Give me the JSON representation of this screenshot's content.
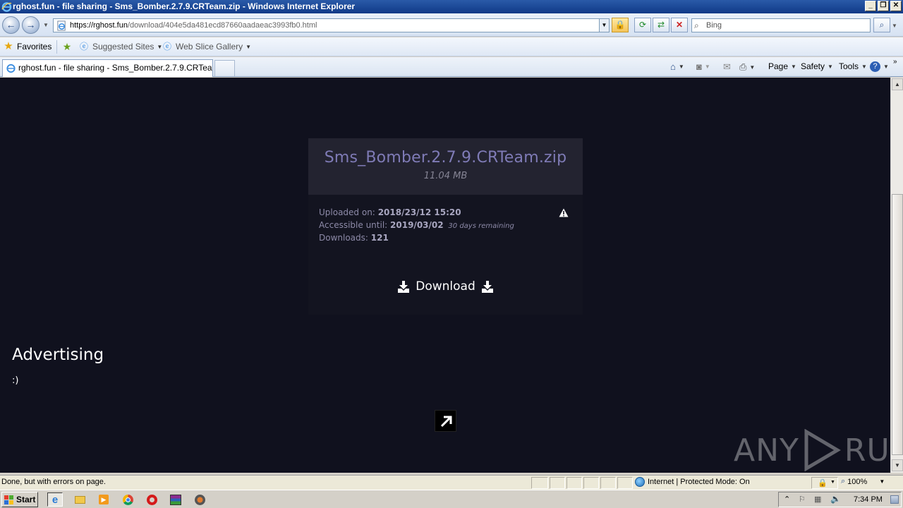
{
  "window": {
    "title": "rghost.fun - file sharing - Sms_Bomber.2.7.9.CRTeam.zip - Windows Internet Explorer",
    "controls": [
      "_",
      "❐",
      "✕"
    ]
  },
  "address_bar": {
    "url_host": "https://rghost.fun",
    "url_path": "/download/404e5da481ecd87660aadaeac3993fb0.html",
    "search_placeholder": "Bing"
  },
  "favorites_bar": {
    "favorites_label": "Favorites",
    "suggested_sites": "Suggested Sites",
    "web_slice_gallery": "Web Slice Gallery"
  },
  "tabs": {
    "active_label": "rghost.fun - file sharing - Sms_Bomber.2.7.9.CRTeam...."
  },
  "command_bar": {
    "page": "Page",
    "safety": "Safety",
    "tools": "Tools"
  },
  "page": {
    "file_name": "Sms_Bomber.2.7.9.CRTeam.zip",
    "file_size": "11.04 MB",
    "uploaded_label": "Uploaded on:",
    "uploaded_value": "2018/23/12 15:20",
    "accessible_label": "Accessible until:",
    "accessible_value": "2019/03/02",
    "accessible_note": "30 days remaining",
    "downloads_label": "Downloads:",
    "downloads_value": "121",
    "download_button": "Download",
    "advertising_title": "Advertising",
    "advertising_body": ":)",
    "watermark_left": "ANY",
    "watermark_right": "RUN"
  },
  "status_bar": {
    "status_text": "Done, but with errors on page.",
    "zone_text": "Internet | Protected Mode: On",
    "zoom_text": "100%"
  },
  "taskbar": {
    "start_label": "Start",
    "clock": "7:34 PM"
  },
  "colors": {
    "page_background": "#10111e",
    "file_card": "#232330",
    "file_name": "#7f7bb6"
  }
}
